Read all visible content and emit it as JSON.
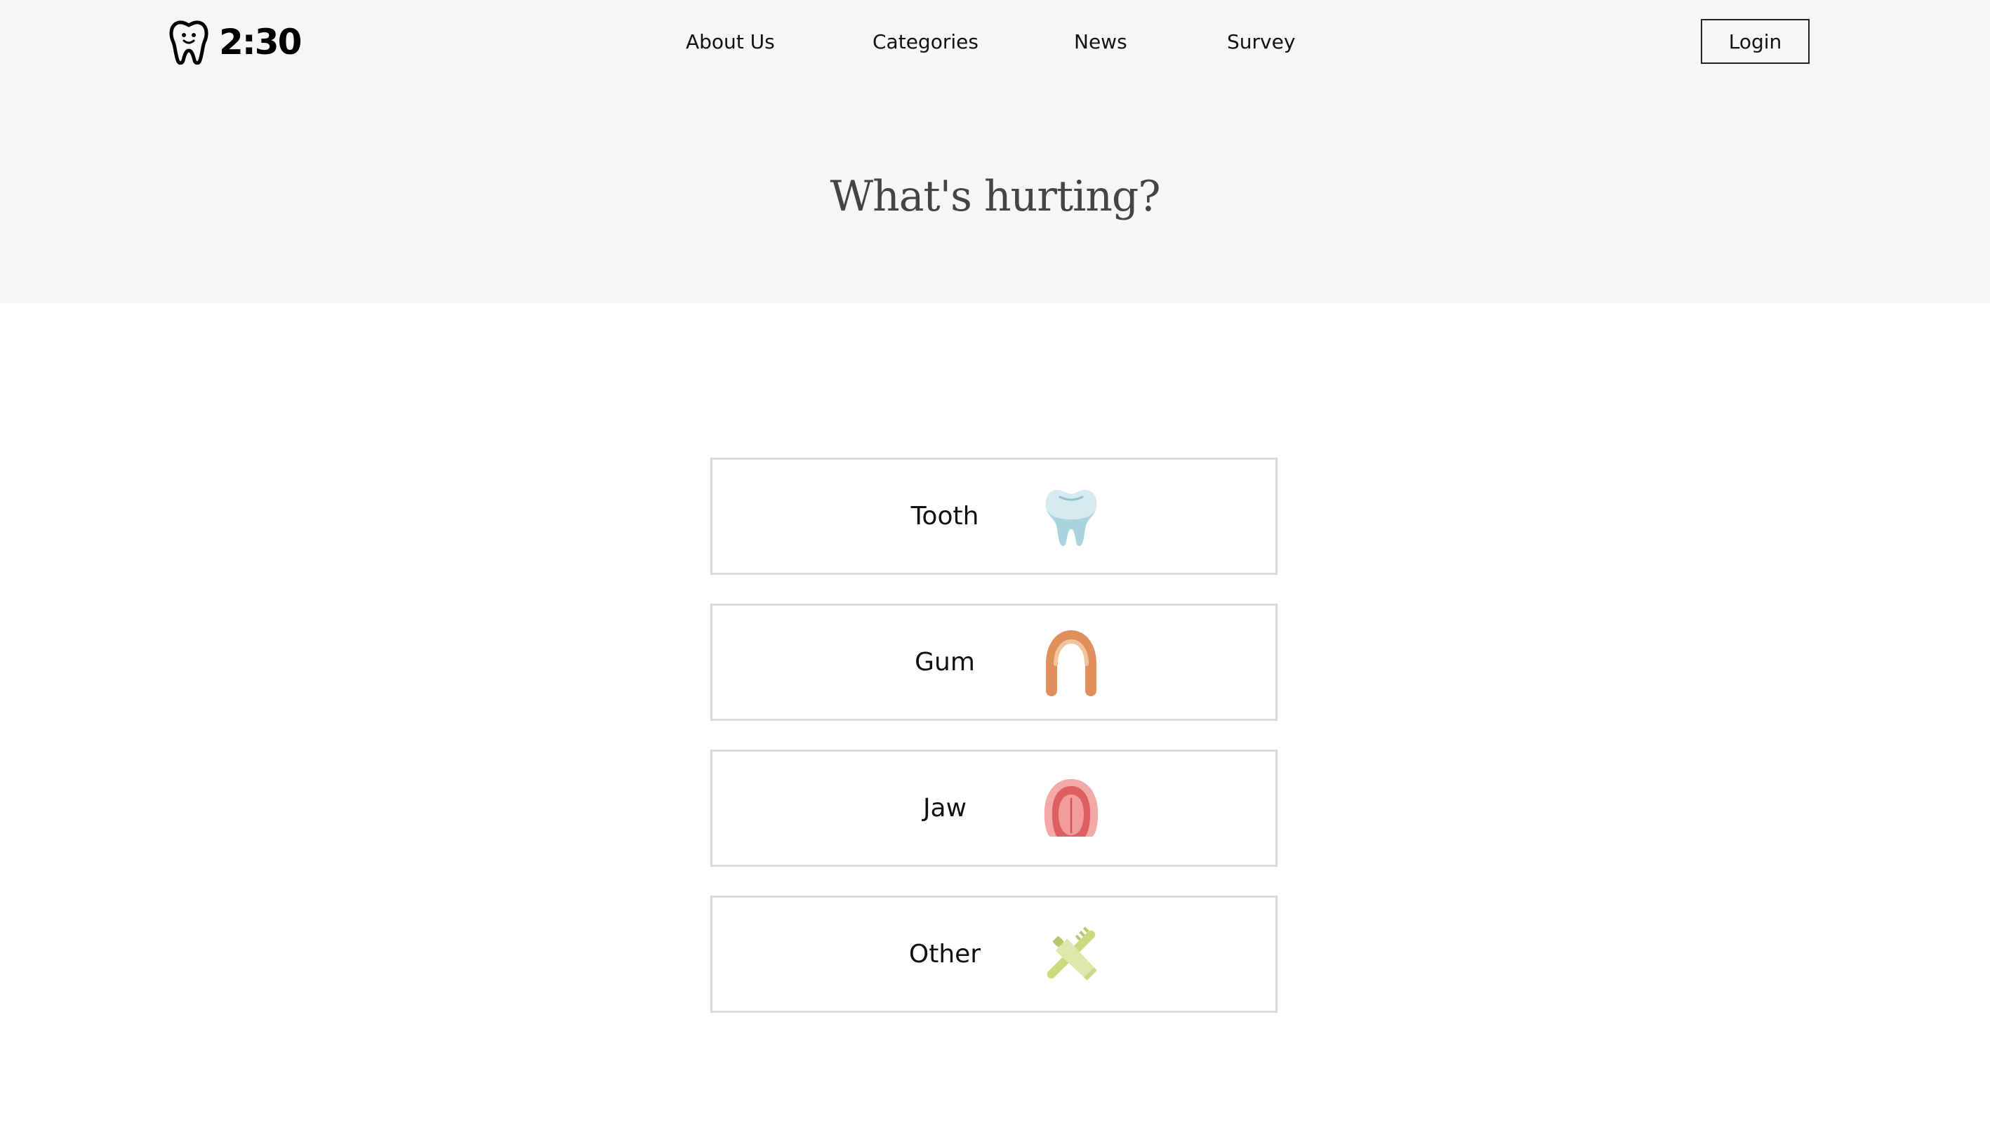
{
  "header": {
    "logo_text": "2:30",
    "logo_icon": "tooth-logo-icon",
    "nav": [
      {
        "label": "About Us"
      },
      {
        "label": "Categories"
      },
      {
        "label": "News"
      },
      {
        "label": "Survey"
      }
    ],
    "login_label": "Login"
  },
  "hero": {
    "title": "What's hurting?"
  },
  "categories": [
    {
      "label": "Tooth",
      "icon": "tooth-icon",
      "color": "#b9dde4"
    },
    {
      "label": "Gum",
      "icon": "gum-icon",
      "color": "#e39a66"
    },
    {
      "label": "Jaw",
      "icon": "jaw-icon",
      "color": "#e06b6b"
    },
    {
      "label": "Other",
      "icon": "toothbrush-toothpaste-icon",
      "color": "#d3e29a"
    }
  ],
  "colors": {
    "header_bg": "#f6f6f6",
    "card_border": "#d9d9d9",
    "title_text": "#444444"
  }
}
